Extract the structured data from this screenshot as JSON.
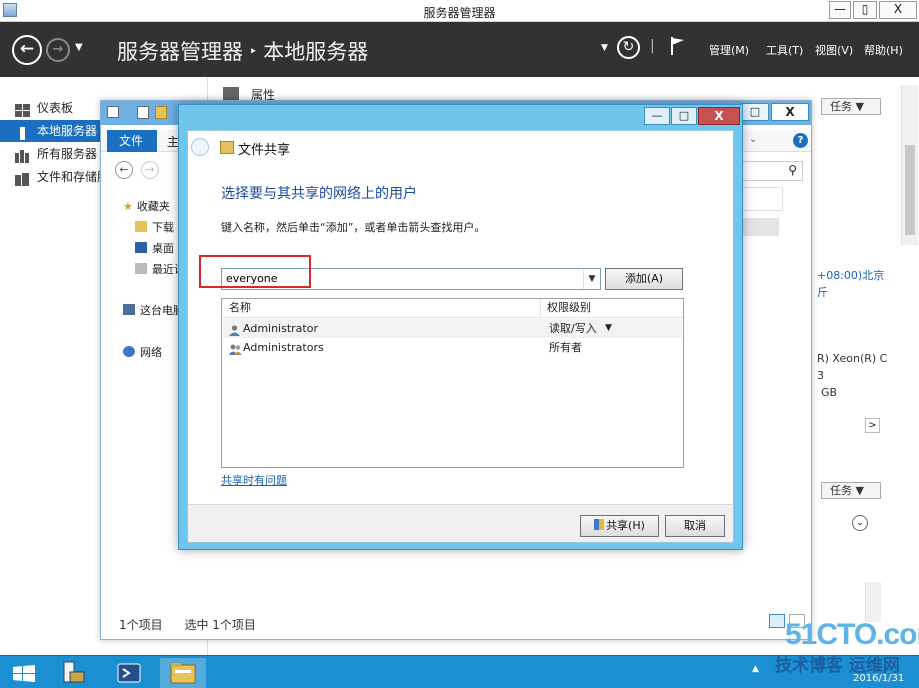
{
  "server_manager": {
    "window_title": "服务器管理器",
    "breadcrumb_root": "服务器管理器",
    "breadcrumb_sep": "‣",
    "breadcrumb_current": "本地服务器",
    "minimize_label": "—",
    "restore_label": "▯",
    "close_label": "X",
    "menus": [
      {
        "label": "管理(M)"
      },
      {
        "label": "工具(T)"
      },
      {
        "label": "视图(V)"
      },
      {
        "label": "帮助(H)"
      }
    ],
    "sidebar": [
      {
        "label": "仪表板"
      },
      {
        "label": "本地服务器"
      },
      {
        "label": "所有服务器"
      },
      {
        "label": "文件和存储服务"
      }
    ],
    "properties_title": "属性",
    "tasks_label": "任务 ▼",
    "right_snippets": {
      "timezone": "+08:00)北京",
      "timezone_cont": "斤",
      "cpu": "R) Xeon(R) C",
      "cpu_cont": "3",
      "memory": "GB"
    }
  },
  "explorer": {
    "file_tab": "文件",
    "home_tab": "主",
    "nav": [
      {
        "label": "收藏夹"
      },
      {
        "label": "下载"
      },
      {
        "label": "桌面"
      },
      {
        "label": "最近访"
      },
      {
        "label": "这台电脑"
      },
      {
        "label": "网络"
      }
    ],
    "status_count": "1个项目",
    "status_selected": "选中 1个项目",
    "close_label": "X"
  },
  "dialog": {
    "title": "文件共享",
    "heading": "选择要与其共享的网络上的用户",
    "instruction": "键入名称，然后单击“添加”，或者单击箭头查找用户。",
    "input_value": "everyone",
    "add_button": "添加(A)",
    "columns": {
      "name": "名称",
      "permission": "权限级别"
    },
    "users": [
      {
        "name": "Administrator",
        "permission": "读取/写入",
        "has_dropdown": true
      },
      {
        "name": "Administrators",
        "permission": "所有者",
        "has_dropdown": false
      }
    ],
    "help_link": "共享时有问题",
    "share_button": "共享(H)",
    "cancel_button": "取消",
    "minimize_label": "—",
    "maximize_label": "□",
    "close_label": "X"
  },
  "taskbar": {
    "watermark_main": "51CTO.com",
    "watermark_sub": "技术博客 运维网",
    "date": "2016/1/31"
  },
  "colors": {
    "header_bg": "#323232",
    "selection_blue": "#1c6fc0",
    "dialog_frame": "#6ec6ed",
    "heading_blue": "#1e4aa3",
    "highlight_red": "#d62a2a",
    "taskbar": "#1b8fd1"
  }
}
